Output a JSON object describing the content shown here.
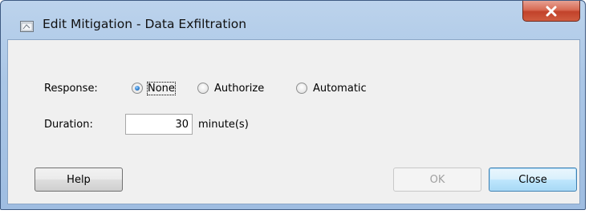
{
  "dialog": {
    "title": "Edit Mitigation - Data Exfiltration",
    "app_icon": "dialog-app-icon",
    "close_icon": "close-x-icon"
  },
  "response": {
    "label": "Response:",
    "options": [
      {
        "label": "None",
        "checked": true
      },
      {
        "label": "Authorize",
        "checked": false
      },
      {
        "label": "Automatic",
        "checked": false
      }
    ]
  },
  "duration": {
    "label": "Duration:",
    "value": "30",
    "unit": "minute(s)"
  },
  "buttons": {
    "help": "Help",
    "ok": "OK",
    "close": "Close"
  },
  "colors": {
    "title_bar": "#aac6e6",
    "close_button": "#c2422a",
    "panel": "#f0f0f0",
    "radio_selected": "#2f7fd0",
    "default_button": "#bee6fd"
  }
}
